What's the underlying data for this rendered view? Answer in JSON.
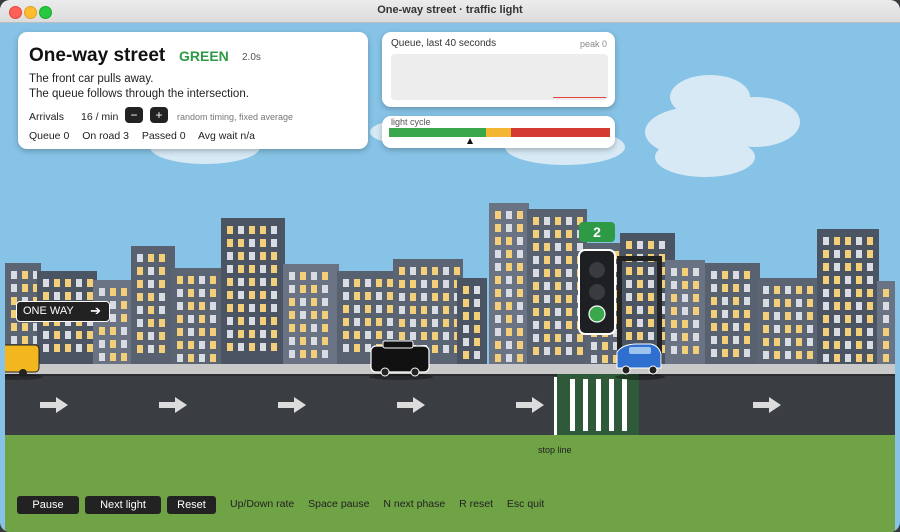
{
  "window": {
    "title": "One-way street · traffic light"
  },
  "info": {
    "title": "One-way street",
    "phase": "GREEN",
    "phase_timer": "2.0s",
    "description_line1": "The front car pulls away.",
    "description_line2": "The queue follows through the intersection.",
    "arrivals_label": "Arrivals",
    "arrivals_value": "16 / min",
    "decrease_label": "−",
    "increase_label": "+",
    "timing_note": "random timing, fixed average",
    "stats": {
      "queue": "Queue 0",
      "on_road": "On road 3",
      "passed": "Passed 0",
      "avg_wait": "Avg wait n/a"
    }
  },
  "queue_graph": {
    "title": "Queue, last 40 seconds",
    "peak": "peak 0",
    "line_color": "#e3413a"
  },
  "light_cycle": {
    "label": "light cycle",
    "segments": [
      {
        "phase": "green",
        "fraction": 0.44,
        "color": "#3aa84a"
      },
      {
        "phase": "yellow",
        "fraction": 0.11,
        "color": "#f2b630"
      },
      {
        "phase": "red",
        "fraction": 0.45,
        "color": "#d43a32"
      }
    ],
    "position": 0.37
  },
  "scene": {
    "oneway_sign": "ONE WAY",
    "oneway_arrow": "arrow-right-icon",
    "light_count": "2",
    "light_state": "green",
    "stop_line_label": "stop line",
    "cars": [
      {
        "name": "yellow-car",
        "color": "#f2b61f"
      },
      {
        "name": "black-van",
        "color": "#111111"
      },
      {
        "name": "blue-car",
        "color": "#2f6fd0"
      }
    ]
  },
  "controls": {
    "pause": "Pause",
    "next_light": "Next light",
    "reset": "Reset"
  },
  "hints": [
    "Up/Down rate",
    "Space pause",
    "N next phase",
    "R reset",
    "Esc quit"
  ],
  "colors": {
    "sky": "#87c3e6",
    "grass": "#6fa345",
    "road": "#3a3d42",
    "green_phase": "#2f9a46"
  }
}
